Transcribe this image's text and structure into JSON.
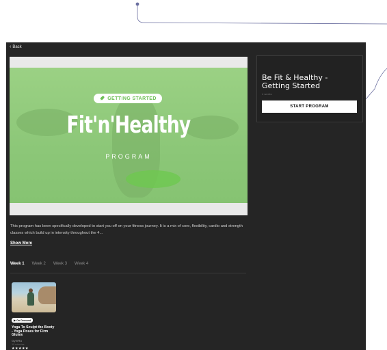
{
  "page": {
    "background": "#ffffff",
    "app_background": "#252525",
    "annotation_color": "#6b6fa0"
  },
  "nav": {
    "back_label": "Back",
    "back_icon": "chevron-left-icon"
  },
  "hero": {
    "badge_icon": "rocket-icon",
    "badge_label": "GETTING STARTED",
    "title": "Fit'n'Healthy",
    "subtitle": "PROGRAM",
    "accent": "#8cc778"
  },
  "program_card": {
    "title": "Be Fit & Healthy - Getting Started",
    "meta": "4 weeks",
    "start_button": "START PROGRAM"
  },
  "description": {
    "text": "This program has been specifically developed to start you off on your fitness journey. It is a mix of core, flexibility, cardio and strength classes which build up in intensity throughout the 4...",
    "show_more": "Show More"
  },
  "tabs": [
    {
      "label": "Week 1",
      "active": true
    },
    {
      "label": "Week 2",
      "active": false
    },
    {
      "label": "Week 3",
      "active": false
    },
    {
      "label": "Week 4",
      "active": false
    }
  ],
  "classes": [
    {
      "badge": "▶ On Demand",
      "title": "Yoga To Sculpt the Booty - Yoga Poses for Firm Glutes",
      "instructor": "GymRa",
      "duration": "10 minutes",
      "rating_stars": "★★★★★",
      "rating": 5
    }
  ]
}
